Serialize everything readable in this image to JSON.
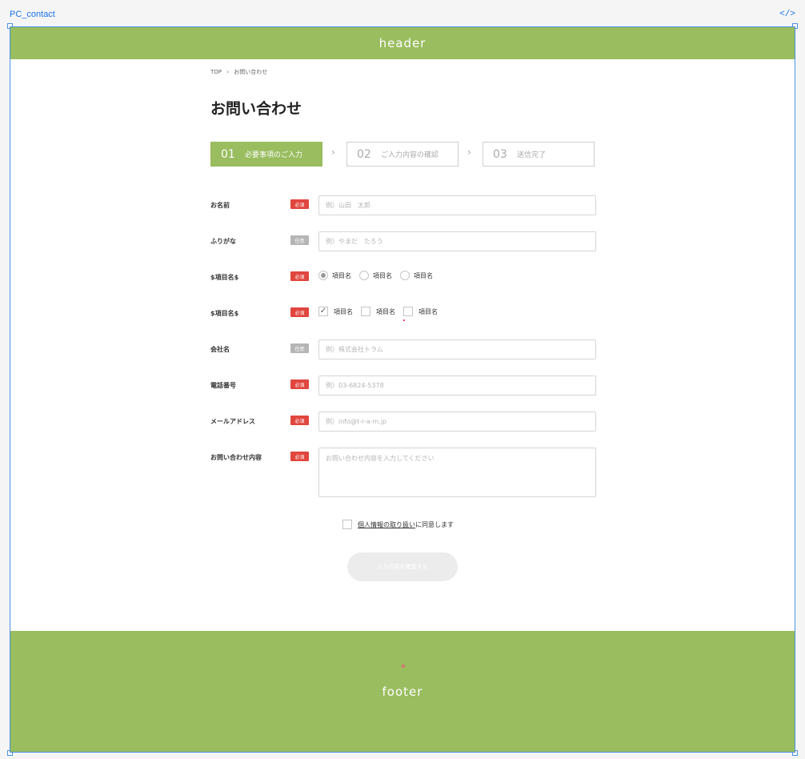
{
  "editor": {
    "frame_label": "PC_contact",
    "code_icon": "</>"
  },
  "header": {
    "text": "header"
  },
  "footer": {
    "text": "footer"
  },
  "breadcrumb": {
    "home": "TOP",
    "separator": "›",
    "current": "お問い合わせ"
  },
  "page_title": "お問い合わせ",
  "steps": [
    {
      "num": "01",
      "label": "必要事項のご入力",
      "active": true
    },
    {
      "num": "02",
      "label": "ご入力内容の確認",
      "active": false
    },
    {
      "num": "03",
      "label": "送信完了",
      "active": false
    }
  ],
  "step_arrow": "›",
  "badges": {
    "required": "必須",
    "optional": "任意"
  },
  "form": {
    "name": {
      "label": "お名前",
      "placeholder": "例）山田　太郎"
    },
    "kana": {
      "label": "ふりがな",
      "placeholder": "例）やまだ　たろう"
    },
    "radio_group": {
      "label": "$項目名$",
      "options": [
        "項目名",
        "項目名",
        "項目名"
      ]
    },
    "check_group": {
      "label": "$項目名$",
      "options": [
        "項目名",
        "項目名",
        "項目名"
      ],
      "check_mark": "✓"
    },
    "company": {
      "label": "会社名",
      "placeholder": "例）株式会社トラム"
    },
    "phone": {
      "label": "電話番号",
      "placeholder": "例）03-6824-5378"
    },
    "email": {
      "label": "メールアドレス",
      "placeholder": "例）info@t-r-a-m.jp"
    },
    "message": {
      "label": "お問い合わせ内容",
      "placeholder": "お問い合わせ内容を入力してください"
    }
  },
  "agree": {
    "link": "個人情報の取り扱い",
    "suffix": "に同意します"
  },
  "submit": {
    "label": "入力内容を確認する"
  },
  "colors": {
    "brand": "#99bd5f",
    "required": "#e0463e",
    "optional": "#b5b5b5"
  }
}
